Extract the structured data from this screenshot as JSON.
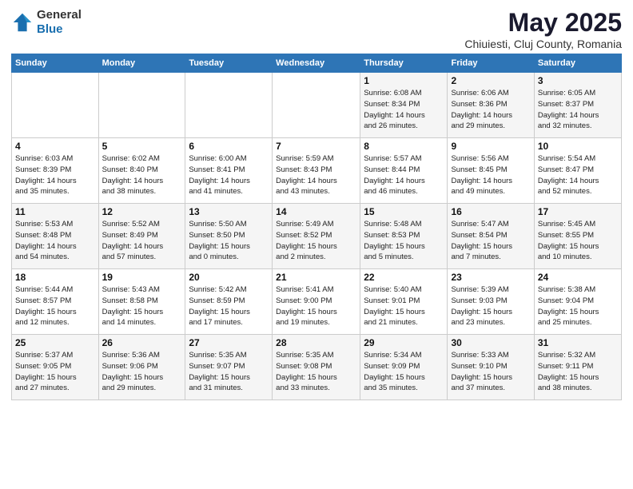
{
  "logo": {
    "general": "General",
    "blue": "Blue"
  },
  "title": {
    "month_year": "May 2025",
    "location": "Chiuiesti, Cluj County, Romania"
  },
  "weekdays": [
    "Sunday",
    "Monday",
    "Tuesday",
    "Wednesday",
    "Thursday",
    "Friday",
    "Saturday"
  ],
  "weeks": [
    [
      {
        "day": "",
        "info": ""
      },
      {
        "day": "",
        "info": ""
      },
      {
        "day": "",
        "info": ""
      },
      {
        "day": "",
        "info": ""
      },
      {
        "day": "1",
        "info": "Sunrise: 6:08 AM\nSunset: 8:34 PM\nDaylight: 14 hours\nand 26 minutes."
      },
      {
        "day": "2",
        "info": "Sunrise: 6:06 AM\nSunset: 8:36 PM\nDaylight: 14 hours\nand 29 minutes."
      },
      {
        "day": "3",
        "info": "Sunrise: 6:05 AM\nSunset: 8:37 PM\nDaylight: 14 hours\nand 32 minutes."
      }
    ],
    [
      {
        "day": "4",
        "info": "Sunrise: 6:03 AM\nSunset: 8:39 PM\nDaylight: 14 hours\nand 35 minutes."
      },
      {
        "day": "5",
        "info": "Sunrise: 6:02 AM\nSunset: 8:40 PM\nDaylight: 14 hours\nand 38 minutes."
      },
      {
        "day": "6",
        "info": "Sunrise: 6:00 AM\nSunset: 8:41 PM\nDaylight: 14 hours\nand 41 minutes."
      },
      {
        "day": "7",
        "info": "Sunrise: 5:59 AM\nSunset: 8:43 PM\nDaylight: 14 hours\nand 43 minutes."
      },
      {
        "day": "8",
        "info": "Sunrise: 5:57 AM\nSunset: 8:44 PM\nDaylight: 14 hours\nand 46 minutes."
      },
      {
        "day": "9",
        "info": "Sunrise: 5:56 AM\nSunset: 8:45 PM\nDaylight: 14 hours\nand 49 minutes."
      },
      {
        "day": "10",
        "info": "Sunrise: 5:54 AM\nSunset: 8:47 PM\nDaylight: 14 hours\nand 52 minutes."
      }
    ],
    [
      {
        "day": "11",
        "info": "Sunrise: 5:53 AM\nSunset: 8:48 PM\nDaylight: 14 hours\nand 54 minutes."
      },
      {
        "day": "12",
        "info": "Sunrise: 5:52 AM\nSunset: 8:49 PM\nDaylight: 14 hours\nand 57 minutes."
      },
      {
        "day": "13",
        "info": "Sunrise: 5:50 AM\nSunset: 8:50 PM\nDaylight: 15 hours\nand 0 minutes."
      },
      {
        "day": "14",
        "info": "Sunrise: 5:49 AM\nSunset: 8:52 PM\nDaylight: 15 hours\nand 2 minutes."
      },
      {
        "day": "15",
        "info": "Sunrise: 5:48 AM\nSunset: 8:53 PM\nDaylight: 15 hours\nand 5 minutes."
      },
      {
        "day": "16",
        "info": "Sunrise: 5:47 AM\nSunset: 8:54 PM\nDaylight: 15 hours\nand 7 minutes."
      },
      {
        "day": "17",
        "info": "Sunrise: 5:45 AM\nSunset: 8:55 PM\nDaylight: 15 hours\nand 10 minutes."
      }
    ],
    [
      {
        "day": "18",
        "info": "Sunrise: 5:44 AM\nSunset: 8:57 PM\nDaylight: 15 hours\nand 12 minutes."
      },
      {
        "day": "19",
        "info": "Sunrise: 5:43 AM\nSunset: 8:58 PM\nDaylight: 15 hours\nand 14 minutes."
      },
      {
        "day": "20",
        "info": "Sunrise: 5:42 AM\nSunset: 8:59 PM\nDaylight: 15 hours\nand 17 minutes."
      },
      {
        "day": "21",
        "info": "Sunrise: 5:41 AM\nSunset: 9:00 PM\nDaylight: 15 hours\nand 19 minutes."
      },
      {
        "day": "22",
        "info": "Sunrise: 5:40 AM\nSunset: 9:01 PM\nDaylight: 15 hours\nand 21 minutes."
      },
      {
        "day": "23",
        "info": "Sunrise: 5:39 AM\nSunset: 9:03 PM\nDaylight: 15 hours\nand 23 minutes."
      },
      {
        "day": "24",
        "info": "Sunrise: 5:38 AM\nSunset: 9:04 PM\nDaylight: 15 hours\nand 25 minutes."
      }
    ],
    [
      {
        "day": "25",
        "info": "Sunrise: 5:37 AM\nSunset: 9:05 PM\nDaylight: 15 hours\nand 27 minutes."
      },
      {
        "day": "26",
        "info": "Sunrise: 5:36 AM\nSunset: 9:06 PM\nDaylight: 15 hours\nand 29 minutes."
      },
      {
        "day": "27",
        "info": "Sunrise: 5:35 AM\nSunset: 9:07 PM\nDaylight: 15 hours\nand 31 minutes."
      },
      {
        "day": "28",
        "info": "Sunrise: 5:35 AM\nSunset: 9:08 PM\nDaylight: 15 hours\nand 33 minutes."
      },
      {
        "day": "29",
        "info": "Sunrise: 5:34 AM\nSunset: 9:09 PM\nDaylight: 15 hours\nand 35 minutes."
      },
      {
        "day": "30",
        "info": "Sunrise: 5:33 AM\nSunset: 9:10 PM\nDaylight: 15 hours\nand 37 minutes."
      },
      {
        "day": "31",
        "info": "Sunrise: 5:32 AM\nSunset: 9:11 PM\nDaylight: 15 hours\nand 38 minutes."
      }
    ]
  ]
}
